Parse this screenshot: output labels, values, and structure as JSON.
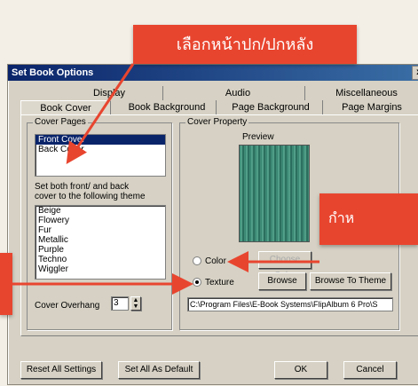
{
  "callouts": {
    "top": "เลือกหน้าปก/ปกหลัง",
    "right": "กำห"
  },
  "dialog": {
    "title": "Set Book Options",
    "close": "x"
  },
  "tabs_top": [
    "Display",
    "Audio",
    "Miscellaneous"
  ],
  "tabs_bottom": [
    "Book Cover",
    "Book Background",
    "Page Background",
    "Page Margins"
  ],
  "cover_pages": {
    "legend": "Cover Pages",
    "items": [
      "Front Cover",
      "Back Cover"
    ],
    "selected_index": 0,
    "theme_note_line1": "Set both front/ and back",
    "theme_note_line2": "cover to the following theme",
    "themes": [
      "Beige",
      "Flowery",
      "Fur",
      "Metallic",
      "Purple",
      "Techno",
      "Wiggler"
    ],
    "overhang_label": "Cover Overhang",
    "overhang_value": "3"
  },
  "cover_property": {
    "legend": "Cover Property",
    "preview_label": "Preview",
    "color_label": "Color",
    "texture_label": "Texture",
    "texture_selected": true,
    "choose_color_label": "Choose Color",
    "browse_label": "Browse",
    "browse_theme_label": "Browse To Theme",
    "path": "C:\\Program Files\\E-Book Systems\\FlipAlbum 6 Pro\\S"
  },
  "footer": {
    "reset": "Reset All Settings",
    "default": "Set All As Default",
    "ok": "OK",
    "cancel": "Cancel"
  },
  "colors": {
    "callout_red": "#e8452f",
    "titlebar": "#0a246a"
  }
}
